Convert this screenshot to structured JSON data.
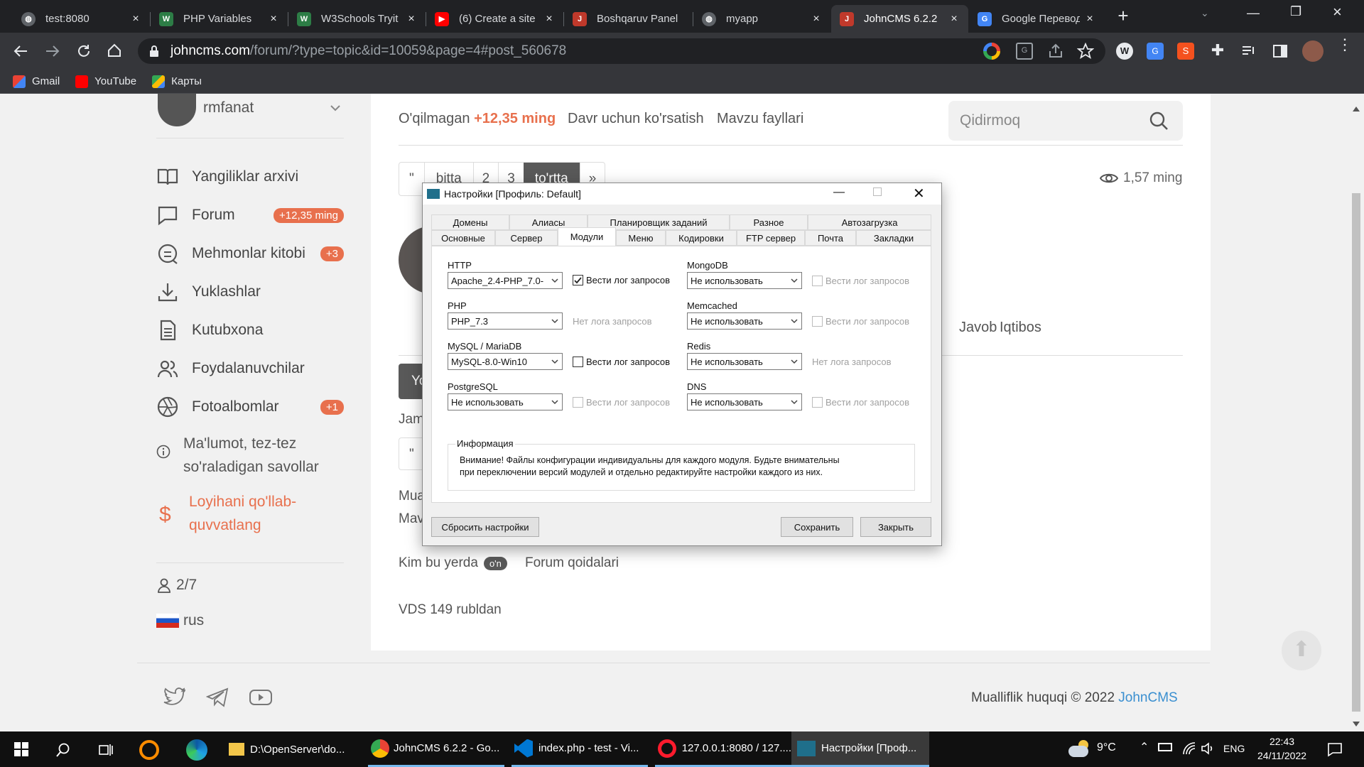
{
  "browser": {
    "tabs": [
      {
        "title": "test:8080"
      },
      {
        "title": "PHP Variables"
      },
      {
        "title": "W3Schools Tryit"
      },
      {
        "title": "(6) Create a site"
      },
      {
        "title": "Boshqaruv Panel"
      },
      {
        "title": "myapp"
      },
      {
        "title": "JohnCMS 6.2.2"
      },
      {
        "title": "Google Перевод"
      }
    ],
    "url_domain": "johncms.com",
    "url_path": "/forum/?type=topic&id=10059&page=4#post_560678",
    "bookmarks": [
      "Gmail",
      "YouTube",
      "Карты"
    ]
  },
  "sidebar": {
    "user": "rmfanat",
    "items": [
      {
        "label": "Yangiliklar arxivi",
        "badge": ""
      },
      {
        "label": "Forum",
        "badge": "+12,35 ming"
      },
      {
        "label": "Mehmonlar kitobi",
        "badge": "+3"
      },
      {
        "label": "Yuklashlar",
        "badge": ""
      },
      {
        "label": "Kutubxona",
        "badge": ""
      },
      {
        "label": "Foydalanuvchilar",
        "badge": ""
      },
      {
        "label": "Fotoalbomlar",
        "badge": "+1"
      }
    ],
    "faq_line1": "Ma'lumot, tez-tez",
    "faq_line2": "so'raladigan savollar",
    "support_line1": "Loyihani qo'llab-",
    "support_line2": "quvvatlang",
    "online": "2/7",
    "lang": "rus"
  },
  "content": {
    "unread_label": "O'qilmagan",
    "unread_count": "+12,35 ming",
    "period_link": "Davr uchun ko'rsatish",
    "files_link": "Mavzu fayllari",
    "search_placeholder": "Qidirmoq",
    "pages": [
      "\"",
      "bitta",
      "2",
      "3",
      "to'rtta",
      "»"
    ],
    "views": "1,57 ming",
    "reply": "Javob",
    "quote": "Iqtibos",
    "btn_partial": "Yo",
    "jam": "Jam",
    "quote_mark": "\"",
    "mua": "Mua",
    "mav": "Mav",
    "who_here": "Kim bu yerda",
    "on_badge": "o'n",
    "forum_rules": "Forum qoidalari",
    "vds": "VDS 149 rubldan",
    "copyright": "Mualliflik huquqi © 2022",
    "copyright_link": "JohnCMS"
  },
  "dialog": {
    "title": "Настройки [Профиль: Default]",
    "tabs_row1": [
      "Домены",
      "Алиасы",
      "Планировщик заданий",
      "Разное",
      "Автозагрузка"
    ],
    "tabs_row2": [
      "Основные",
      "Сервер",
      "Модули",
      "Меню",
      "Кодировки",
      "FTP сервер",
      "Почта",
      "Закладки"
    ],
    "active_tab": "Модули",
    "http_label": "HTTP",
    "http_value": "Apache_2.4-PHP_7.0-",
    "http_log": "Вести лог запросов",
    "php_label": "PHP",
    "php_value": "PHP_7.3",
    "php_log": "Нет лога запросов",
    "mysql_label": "MySQL / MariaDB",
    "mysql_value": "MySQL-8.0-Win10",
    "mysql_log": "Вести лог запросов",
    "pg_label": "PostgreSQL",
    "pg_value": "Не использовать",
    "pg_log": "Вести лог запросов",
    "mongo_label": "MongoDB",
    "mongo_value": "Не использовать",
    "mongo_log": "Вести лог запросов",
    "memc_label": "Memcached",
    "memc_value": "Не использовать",
    "memc_log": "Вести лог запросов",
    "redis_label": "Redis",
    "redis_value": "Не использовать",
    "redis_log": "Нет лога запросов",
    "dns_label": "DNS",
    "dns_value": "Не использовать",
    "dns_log": "Вести лог запросов",
    "info_title": "Информация",
    "info_line1": "Внимание! Файлы конфигурации индивидуальны для каждого модуля. Будьте внимательны",
    "info_line2": "при переключении версий модулей и отдельно редактируйте настройки каждого из них.",
    "reset": "Сбросить настройки",
    "save": "Сохранить",
    "close": "Закрыть"
  },
  "taskbar": {
    "apps": [
      {
        "title": "D:\\OpenServer\\do..."
      },
      {
        "title": "JohnCMS 6.2.2 - Go..."
      },
      {
        "title": "index.php - test - Vi..."
      },
      {
        "title": "127.0.0.1:8080 / 127...."
      },
      {
        "title": "Настройки [Проф..."
      }
    ],
    "weather": "9°C",
    "lang": "ENG",
    "time": "22:43",
    "date": "24/11/2022"
  },
  "colors": {
    "accent": "#e8704d",
    "link": "#3a8fd0",
    "active_page": "#595959"
  }
}
